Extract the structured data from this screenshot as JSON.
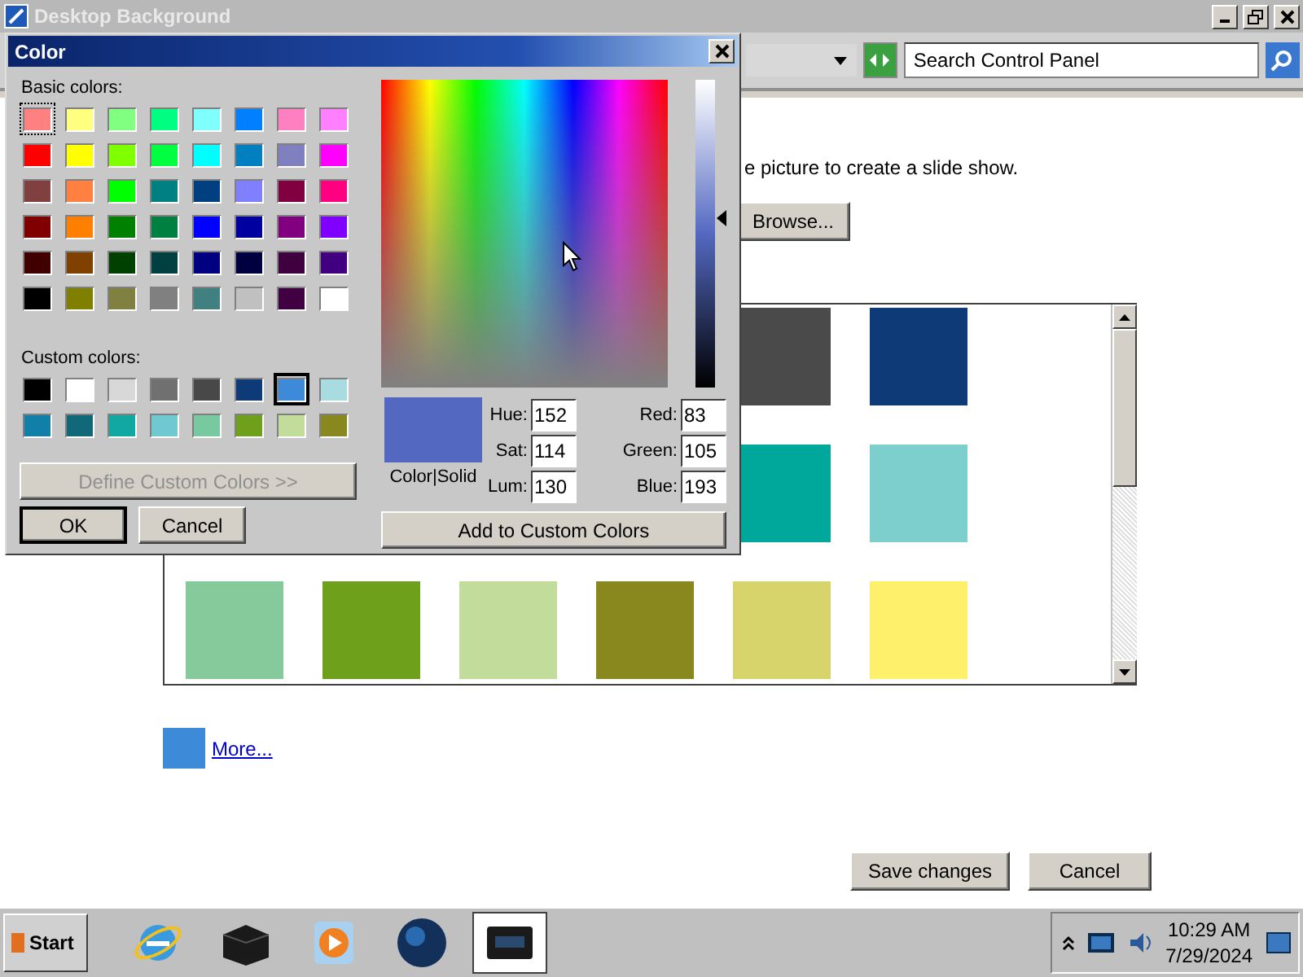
{
  "window": {
    "title": "Desktop Background"
  },
  "toolbar": {
    "search": {
      "placeholder": "Search Control Panel"
    }
  },
  "content": {
    "description": "e picture to create a slide show.",
    "browse_button": "Browse...",
    "swatch_rows": [
      {
        "swatches": [
          {
            "color": "#4a4a4a"
          },
          {
            "color": "#0f3a78"
          }
        ]
      },
      {
        "swatches": [
          {
            "color": "#00a89c"
          },
          {
            "color": "#7ccfcc"
          }
        ]
      },
      {
        "swatches": [
          {
            "color": "#86c99a"
          },
          {
            "color": "#6fa01c"
          },
          {
            "color": "#c2dc9c"
          },
          {
            "color": "#88881e"
          },
          {
            "color": "#d8d46c"
          },
          {
            "color": "#fff06c"
          }
        ]
      }
    ],
    "more": {
      "color": "#3c8ad8",
      "link": "More..."
    },
    "buttons": [
      "Save changes",
      "Cancel"
    ]
  },
  "color_dialog": {
    "title": "Color",
    "basic_label": "Basic colors:",
    "basic_colors": [
      {
        "color": "#ff8080",
        "selected": true
      },
      {
        "color": "#ffff80",
        "selected": false
      },
      {
        "color": "#80ff80",
        "selected": false
      },
      {
        "color": "#00ff80",
        "selected": false
      },
      {
        "color": "#80ffff",
        "selected": false
      },
      {
        "color": "#0080ff",
        "selected": false
      },
      {
        "color": "#ff80c0",
        "selected": false
      },
      {
        "color": "#ff80ff",
        "selected": false
      },
      {
        "color": "#ff0000",
        "selected": false
      },
      {
        "color": "#ffff00",
        "selected": false
      },
      {
        "color": "#80ff00",
        "selected": false
      },
      {
        "color": "#00ff40",
        "selected": false
      },
      {
        "color": "#00ffff",
        "selected": false
      },
      {
        "color": "#0080c0",
        "selected": false
      },
      {
        "color": "#8080c0",
        "selected": false
      },
      {
        "color": "#ff00ff",
        "selected": false
      },
      {
        "color": "#804040",
        "selected": false
      },
      {
        "color": "#ff8040",
        "selected": false
      },
      {
        "color": "#00ff00",
        "selected": false
      },
      {
        "color": "#008080",
        "selected": false
      },
      {
        "color": "#004080",
        "selected": false
      },
      {
        "color": "#8080ff",
        "selected": false
      },
      {
        "color": "#800040",
        "selected": false
      },
      {
        "color": "#ff0080",
        "selected": false
      },
      {
        "color": "#800000",
        "selected": false
      },
      {
        "color": "#ff8000",
        "selected": false
      },
      {
        "color": "#008000",
        "selected": false
      },
      {
        "color": "#008040",
        "selected": false
      },
      {
        "color": "#0000ff",
        "selected": false
      },
      {
        "color": "#0000a0",
        "selected": false
      },
      {
        "color": "#800080",
        "selected": false
      },
      {
        "color": "#8000ff",
        "selected": false
      },
      {
        "color": "#400000",
        "selected": false
      },
      {
        "color": "#804000",
        "selected": false
      },
      {
        "color": "#004000",
        "selected": false
      },
      {
        "color": "#004040",
        "selected": false
      },
      {
        "color": "#000080",
        "selected": false
      },
      {
        "color": "#000040",
        "selected": false
      },
      {
        "color": "#400040",
        "selected": false
      },
      {
        "color": "#400080",
        "selected": false
      },
      {
        "color": "#000000",
        "selected": false
      },
      {
        "color": "#808000",
        "selected": false
      },
      {
        "color": "#808040",
        "selected": false
      },
      {
        "color": "#808080",
        "selected": false
      },
      {
        "color": "#408080",
        "selected": false
      },
      {
        "color": "#c0c0c0",
        "selected": false
      },
      {
        "color": "#400041",
        "selected": false
      },
      {
        "color": "#ffffff",
        "selected": false
      }
    ],
    "custom_label": "Custom colors:",
    "custom_colors": [
      {
        "color": "#000000",
        "selected": false
      },
      {
        "color": "#ffffff",
        "selected": false
      },
      {
        "color": "#d8d8d8",
        "selected": false
      },
      {
        "color": "#707070",
        "selected": false
      },
      {
        "color": "#484848",
        "selected": false
      },
      {
        "color": "#0f3a78",
        "selected": false
      },
      {
        "color": "#3c8ad8",
        "selected": true
      },
      {
        "color": "#a8dce0",
        "selected": false
      },
      {
        "color": "#1080a8",
        "selected": false
      },
      {
        "color": "#106878",
        "selected": false
      },
      {
        "color": "#10a8a0",
        "selected": false
      },
      {
        "color": "#70c8d0",
        "selected": false
      },
      {
        "color": "#78c8a0",
        "selected": false
      },
      {
        "color": "#6fa01c",
        "selected": false
      },
      {
        "color": "#c2dc9c",
        "selected": false
      },
      {
        "color": "#88881e",
        "selected": false
      }
    ],
    "define_button": {
      "label": "Define Custom Colors >>",
      "disabled": true
    },
    "ok_button": "OK",
    "cancel_button": "Cancel",
    "luminance": {
      "level": 0.55
    },
    "preview": {
      "color": "#5369c1",
      "label": "Color|Solid"
    },
    "fields": [
      {
        "label": "Hue:",
        "value": "152"
      },
      {
        "label": "Red:",
        "value": "83"
      },
      {
        "label": "Sat:",
        "value": "114"
      },
      {
        "label": "Green:",
        "value": "105"
      },
      {
        "label": "Lum:",
        "value": "130"
      },
      {
        "label": "Blue:",
        "value": "193"
      }
    ],
    "add_button": "Add to Custom Colors"
  },
  "taskbar": {
    "start": "Start",
    "apps": [
      {
        "kind": "browser",
        "active": false
      },
      {
        "kind": "box",
        "active": false
      },
      {
        "kind": "media",
        "active": false
      },
      {
        "kind": "globe",
        "active": false
      },
      {
        "kind": "monitor",
        "active": true
      }
    ],
    "clock": {
      "time": "10:29 AM",
      "date": "7/29/2024"
    }
  }
}
